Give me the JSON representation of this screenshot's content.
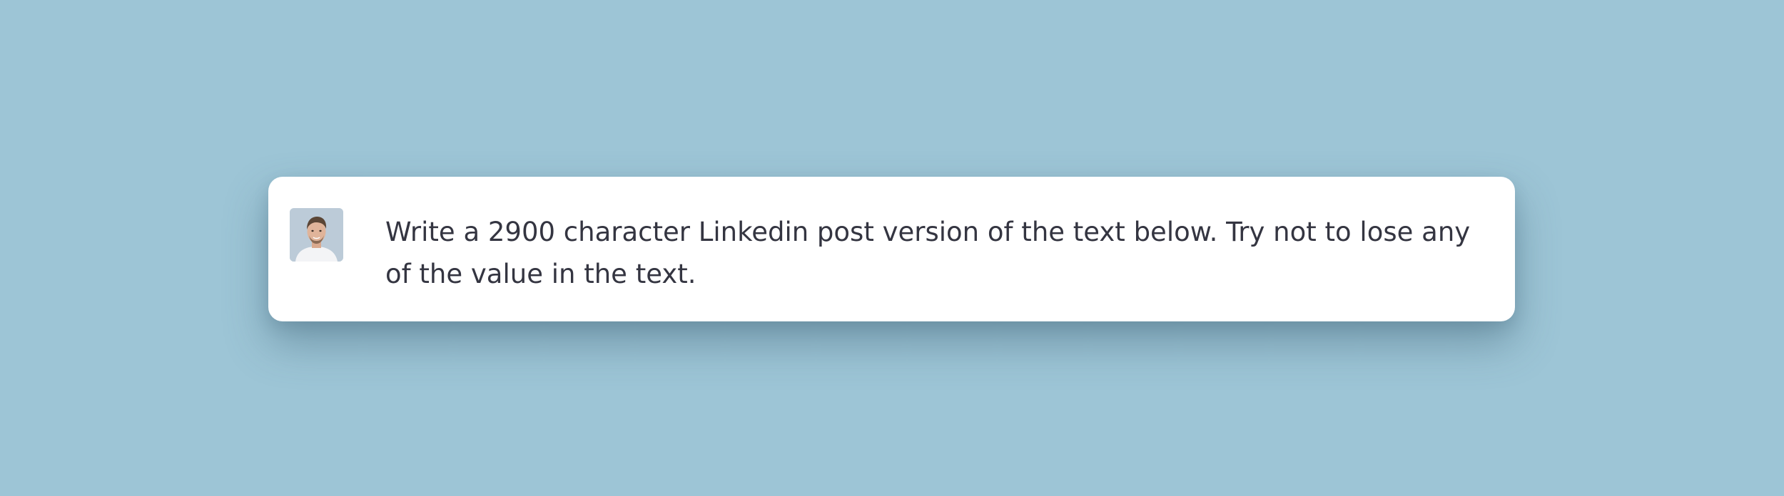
{
  "message": {
    "avatar_icon": "user-avatar-photo",
    "text": "Write a 2900 character Linkedin post version of the text below. Try not to lose any of the value in the text."
  },
  "colors": {
    "background": "#9dc5d6",
    "card": "#ffffff",
    "text": "#343541"
  }
}
